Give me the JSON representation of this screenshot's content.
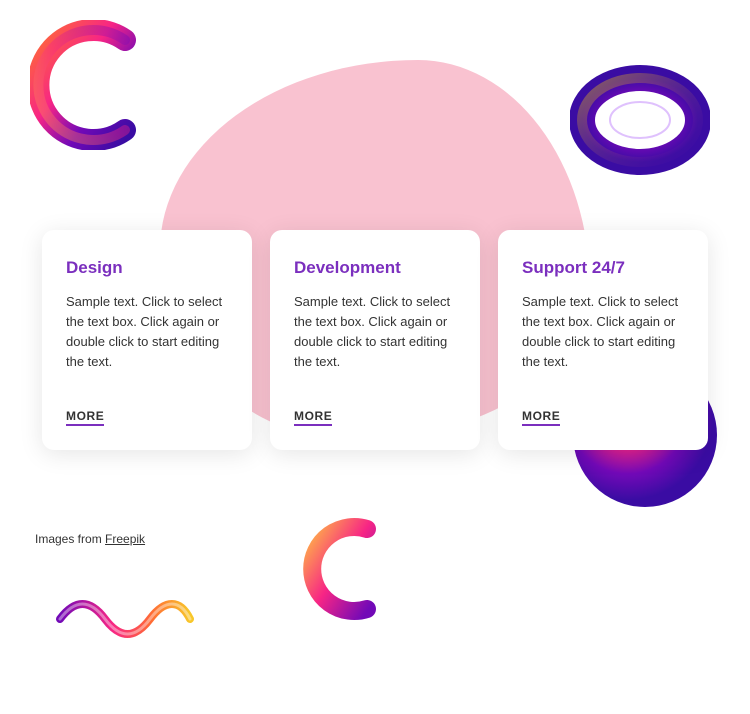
{
  "shapes": {
    "c_top_left": "gradient-c-shape",
    "torus_top_right": "gradient-torus-shape",
    "sphere_bottom_right": "gradient-sphere-shape",
    "c_bottom_center": "gradient-c-small-shape",
    "wave_bottom_left": "gradient-wave-shape"
  },
  "cards": [
    {
      "title": "Design",
      "text": "Sample text. Click to select the text box. Click again or double click to start editing the text.",
      "more_label": "MORE",
      "id": "design-card"
    },
    {
      "title": "Development",
      "text": "Sample text. Click to select the text box. Click again or double click to start editing the text.",
      "more_label": "MORE",
      "id": "development-card"
    },
    {
      "title": "Support 24/7",
      "text": "Sample text. Click to select the text box. Click again or double click to start editing the text.",
      "more_label": "MORE",
      "id": "support-card"
    }
  ],
  "footer": {
    "text": "Images from ",
    "link_label": "Freepik",
    "link_href": "#"
  },
  "colors": {
    "accent": "#7b2fbe",
    "blob_pink": "#f9c2d0",
    "card_bg": "#ffffff"
  }
}
